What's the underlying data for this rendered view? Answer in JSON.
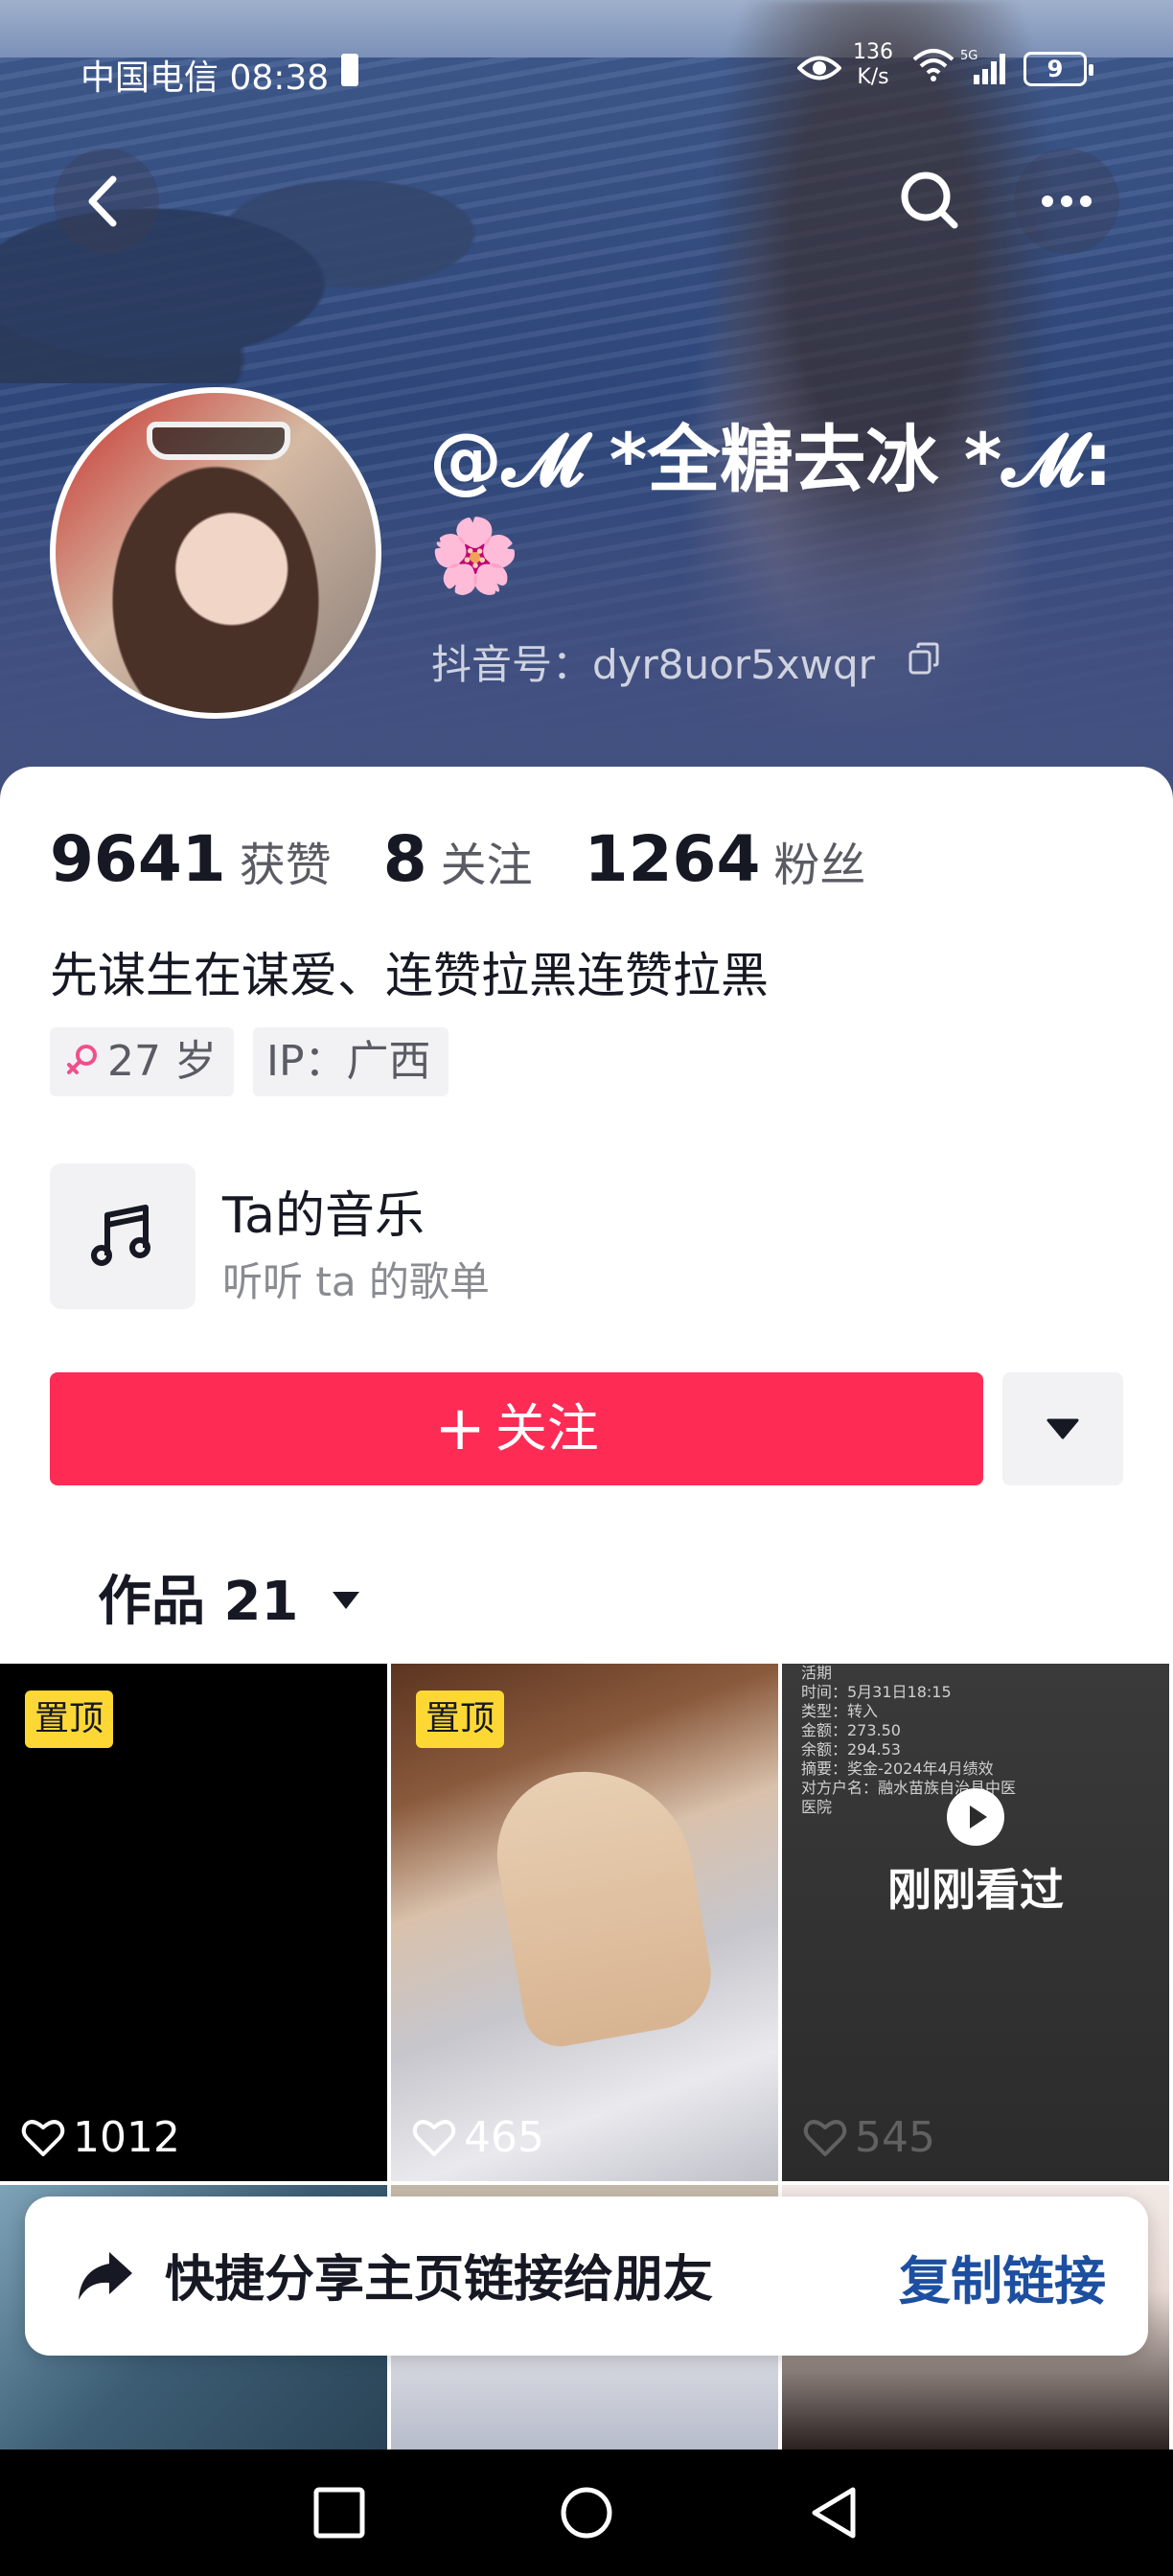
{
  "status_bar": {
    "carrier_time": "中国电信 08:38",
    "net_speed_value": "136",
    "net_speed_unit": "K/s",
    "network_type": "5G",
    "battery": "9"
  },
  "profile": {
    "display_name": "@𝓜 *全糖去冰 *𝓜:🌸",
    "douyin_id": "抖音号：dyr8uor5xwqr"
  },
  "stats": [
    {
      "value": "9641",
      "label": "获赞"
    },
    {
      "value": "8",
      "label": "关注"
    },
    {
      "value": "1264",
      "label": "粉丝"
    }
  ],
  "bio": "先谋生在谋爱、连赞拉黑连赞拉黑",
  "tags": {
    "age": "27 岁",
    "ip": "IP：广西"
  },
  "music": {
    "title": "Ta的音乐",
    "subtitle": "听听 ta 的歌单"
  },
  "actions": {
    "follow_plus": "+",
    "follow_label": "关注"
  },
  "works_tab": {
    "label": "作品 21"
  },
  "grid": {
    "pinned_label": "置顶",
    "recently_viewed": "刚刚看过",
    "items": [
      {
        "likes": "1012"
      },
      {
        "likes": "465"
      },
      {
        "likes": "545"
      }
    ],
    "receipt_lines": [
      "活期",
      "时间：5月31日18:15",
      "类型：转入",
      "金额：273.50",
      "余额：294.53",
      "摘要：奖金-2024年4月绩效",
      "对方户名：融水苗族自治县中医",
      "医院"
    ]
  },
  "share_bar": {
    "text": "快捷分享主页链接给朋友",
    "copy_link": "复制链接"
  },
  "colors": {
    "follow_button": "#fe2c55",
    "pin_badge": "#fdd835",
    "copy_link": "#1d4fa0"
  }
}
